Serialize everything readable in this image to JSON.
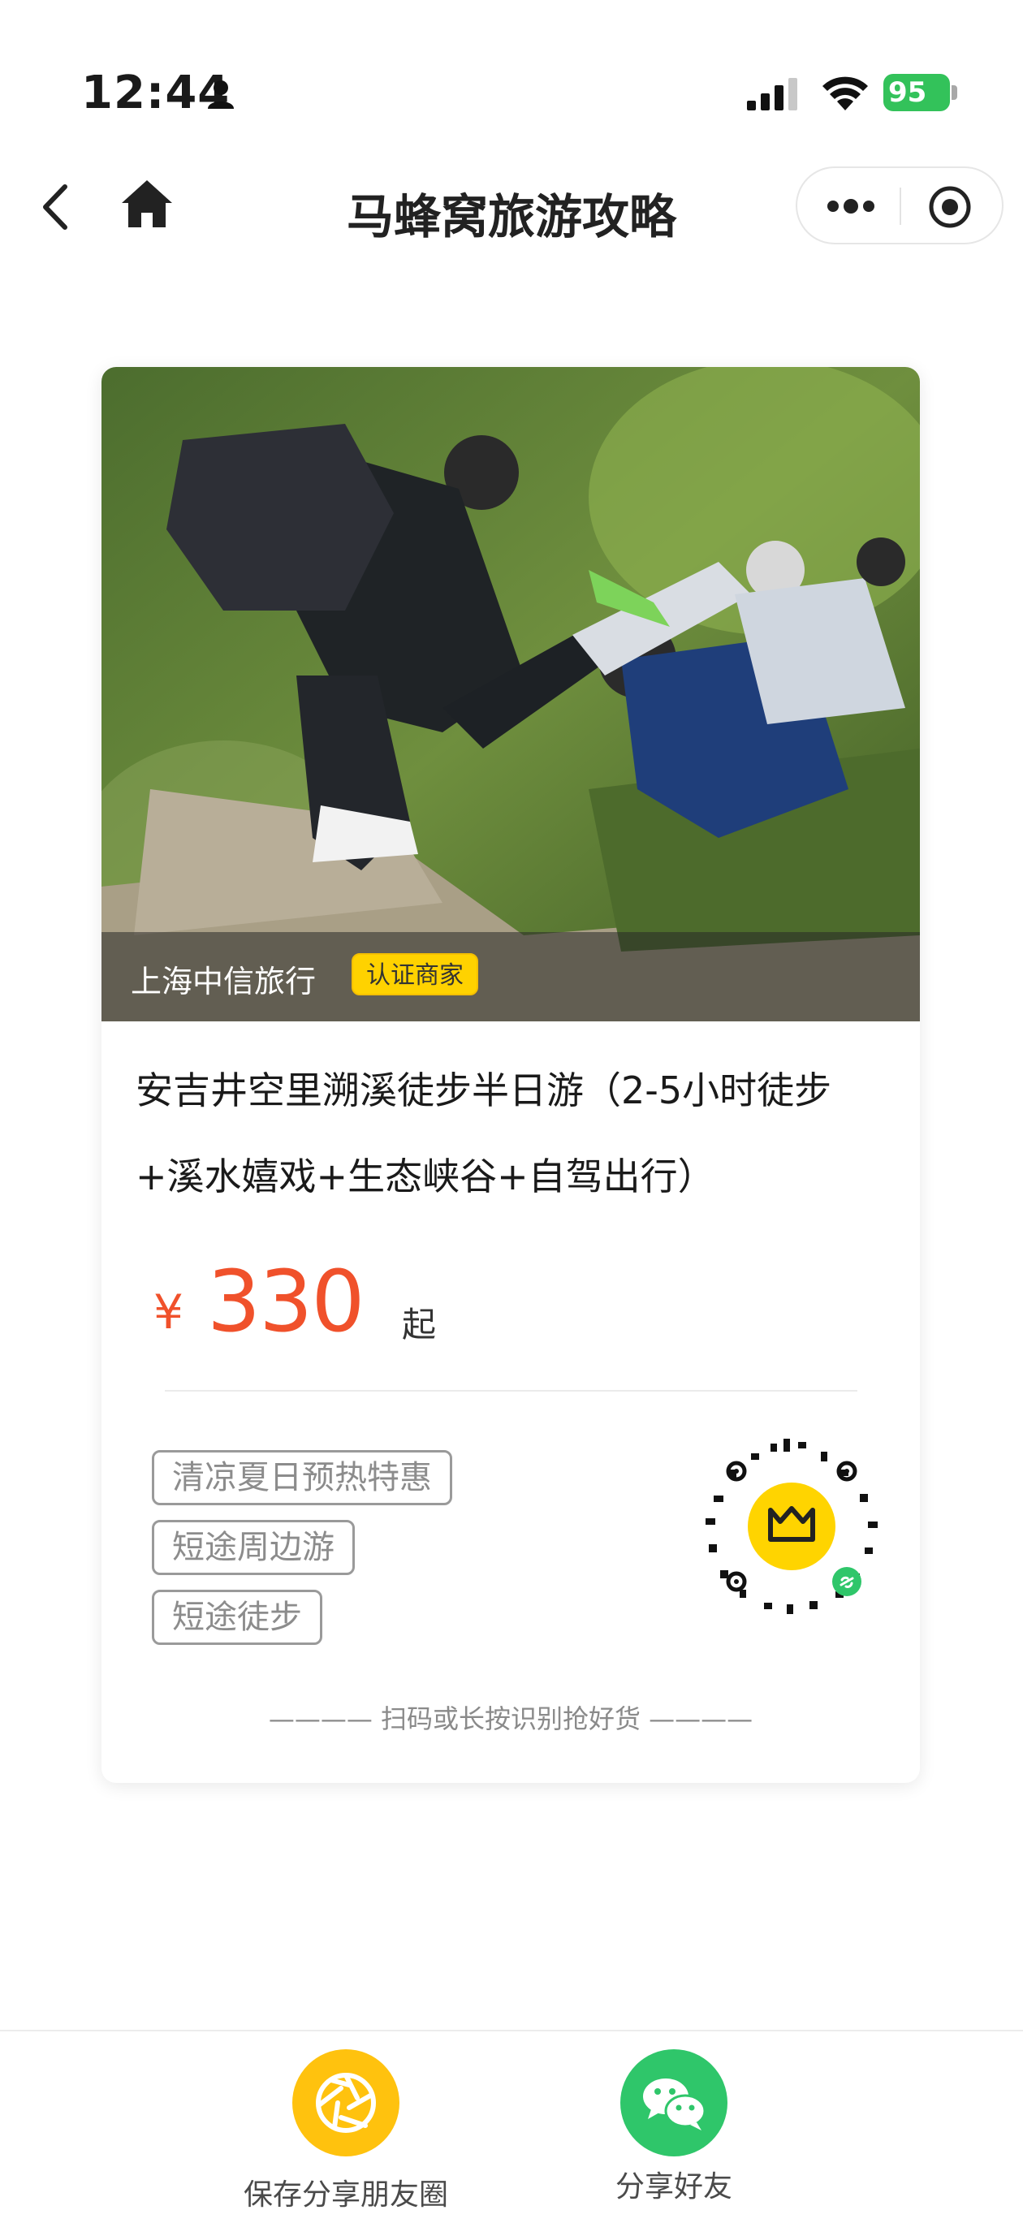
{
  "status_bar": {
    "time": "12:44",
    "battery": "95"
  },
  "nav": {
    "title": "马蜂窝旅游攻略"
  },
  "card": {
    "merchant": "上海中信旅行",
    "merchant_badge": "认证商家",
    "title": "安吉井空里溯溪徒步半日游（2-5小时徒步+溪水嬉戏+生态峡谷+自驾出行）",
    "currency": "¥",
    "price": "330",
    "price_suffix": "起",
    "tags": [
      "清凉夏日预热特惠",
      "短途周边游",
      "短途徒步"
    ],
    "hint": "———— 扫码或长按识别抢好货 ————"
  },
  "bottom_bar": {
    "save_label": "保存分享朋友圈",
    "share_label": "分享好友"
  },
  "colors": {
    "price": "#f0512b",
    "badge": "#ffd200",
    "moments": "#ffc20e",
    "wechat": "#2fc66a"
  }
}
